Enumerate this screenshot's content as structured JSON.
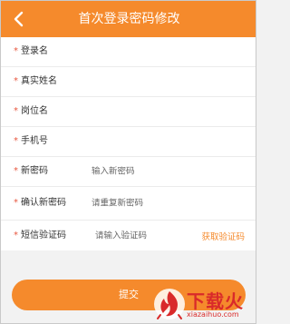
{
  "header": {
    "title": "首次登录密码修改",
    "back_icon": "chevron-left-icon"
  },
  "form": {
    "fields": [
      {
        "label": "登录名",
        "required": "*"
      },
      {
        "label": "真实姓名",
        "required": "*"
      },
      {
        "label": "岗位名",
        "required": "*"
      },
      {
        "label": "手机号",
        "required": "*"
      },
      {
        "label": "新密码",
        "required": "*",
        "placeholder": "输入新密码"
      },
      {
        "label": "确认新密码",
        "required": "*",
        "placeholder": "请重复新密码"
      },
      {
        "label": "短信验证码",
        "required": "*",
        "placeholder": "请输入验证码",
        "action": "获取验证码"
      }
    ]
  },
  "submit_label": "提交",
  "watermark": {
    "brand": "下载火",
    "url": "xiazaihuo.com"
  },
  "colors": {
    "accent": "#f58a2c",
    "required": "#e8573f",
    "watermark": "#d92a2a"
  }
}
